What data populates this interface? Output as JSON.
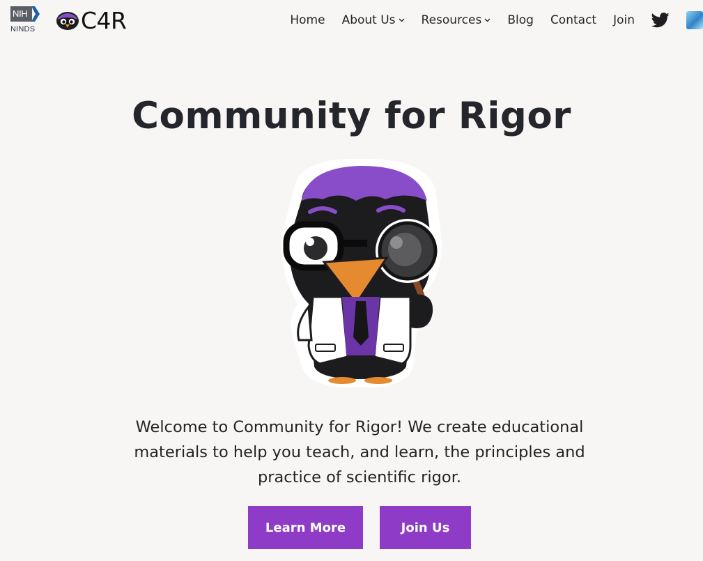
{
  "header": {
    "nih_logo": {
      "badge": "NIH",
      "subtitle": "NINDS"
    },
    "site_name": "C4R",
    "nav": [
      {
        "label": "Home",
        "has_dropdown": false
      },
      {
        "label": "About Us",
        "has_dropdown": true
      },
      {
        "label": "Resources",
        "has_dropdown": true
      },
      {
        "label": "Blog",
        "has_dropdown": false
      },
      {
        "label": "Contact",
        "has_dropdown": false
      },
      {
        "label": "Join",
        "has_dropdown": false
      }
    ],
    "social": {
      "twitter_icon": "twitter-icon",
      "partner_icon": "partner-logo-icon"
    }
  },
  "hero": {
    "title": "Community for Rigor",
    "mascot": "crow-scientist-mascot",
    "intro": "Welcome to Community for Rigor! We create educational materials to help you teach, and learn, the principles and practice of scientific rigor.",
    "buttons": {
      "learn_more": "Learn More",
      "join_us": "Join Us"
    }
  },
  "colors": {
    "background": "#f7f6f4",
    "accent": "#8e3cc7",
    "text": "#222326",
    "nih_badge": "#5a5f66",
    "nih_chevron": "#1f5fa8"
  }
}
